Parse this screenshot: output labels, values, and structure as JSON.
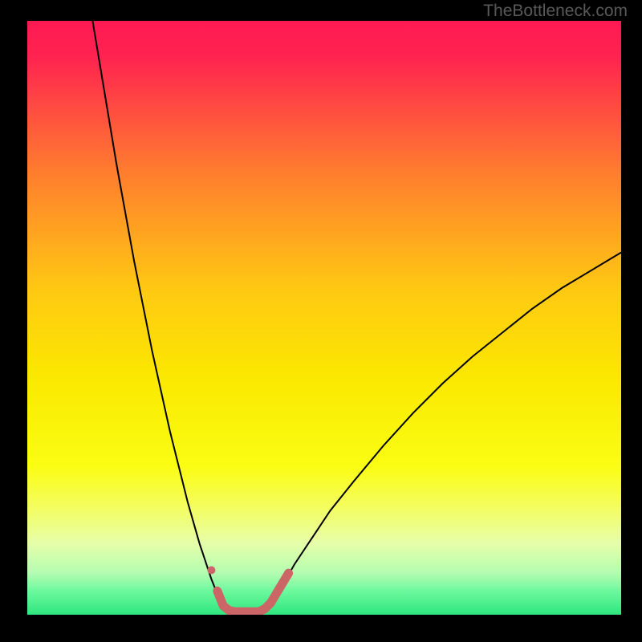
{
  "watermark": "TheBottleneck.com",
  "chart_data": {
    "type": "line",
    "title": "",
    "xlabel": "",
    "ylabel": "",
    "xlim": [
      0,
      100
    ],
    "ylim": [
      0,
      100
    ],
    "background_gradient": {
      "stops": [
        {
          "offset": 0.0,
          "color": "#ff1a52"
        },
        {
          "offset": 0.06,
          "color": "#ff2350"
        },
        {
          "offset": 0.25,
          "color": "#ff7b2f"
        },
        {
          "offset": 0.45,
          "color": "#ffc813"
        },
        {
          "offset": 0.6,
          "color": "#fbe800"
        },
        {
          "offset": 0.75,
          "color": "#fafd13"
        },
        {
          "offset": 0.82,
          "color": "#f4fd61"
        },
        {
          "offset": 0.88,
          "color": "#e6feaa"
        },
        {
          "offset": 0.93,
          "color": "#b3fdb0"
        },
        {
          "offset": 0.96,
          "color": "#6df89e"
        },
        {
          "offset": 1.0,
          "color": "#2ee77f"
        }
      ]
    },
    "series": [
      {
        "name": "left-curve",
        "color": "#000000",
        "width": 2.0,
        "points": [
          {
            "x": 11.0,
            "y": 100.0
          },
          {
            "x": 12.0,
            "y": 94.0
          },
          {
            "x": 13.0,
            "y": 88.0
          },
          {
            "x": 14.0,
            "y": 82.0
          },
          {
            "x": 15.0,
            "y": 76.0
          },
          {
            "x": 16.0,
            "y": 70.5
          },
          {
            "x": 17.0,
            "y": 65.0
          },
          {
            "x": 18.0,
            "y": 59.5
          },
          {
            "x": 19.0,
            "y": 54.5
          },
          {
            "x": 20.0,
            "y": 49.5
          },
          {
            "x": 21.0,
            "y": 44.5
          },
          {
            "x": 22.0,
            "y": 40.0
          },
          {
            "x": 23.0,
            "y": 35.5
          },
          {
            "x": 24.0,
            "y": 31.0
          },
          {
            "x": 25.0,
            "y": 27.0
          },
          {
            "x": 26.0,
            "y": 23.0
          },
          {
            "x": 27.0,
            "y": 19.0
          },
          {
            "x": 28.0,
            "y": 15.5
          },
          {
            "x": 29.0,
            "y": 12.0
          },
          {
            "x": 30.0,
            "y": 9.0
          },
          {
            "x": 31.0,
            "y": 6.0
          },
          {
            "x": 32.0,
            "y": 3.5
          },
          {
            "x": 33.0,
            "y": 1.5
          },
          {
            "x": 34.0,
            "y": 0.5
          },
          {
            "x": 35.0,
            "y": 0.0
          }
        ]
      },
      {
        "name": "right-curve",
        "color": "#000000",
        "width": 2.0,
        "points": [
          {
            "x": 35.0,
            "y": 0.0
          },
          {
            "x": 36.0,
            "y": 0.0
          },
          {
            "x": 37.0,
            "y": 0.0
          },
          {
            "x": 38.0,
            "y": 0.0
          },
          {
            "x": 39.0,
            "y": 0.0
          },
          {
            "x": 40.0,
            "y": 0.5
          },
          {
            "x": 41.0,
            "y": 2.0
          },
          {
            "x": 43.0,
            "y": 5.0
          },
          {
            "x": 45.0,
            "y": 8.5
          },
          {
            "x": 48.0,
            "y": 13.0
          },
          {
            "x": 51.0,
            "y": 17.5
          },
          {
            "x": 55.0,
            "y": 22.5
          },
          {
            "x": 60.0,
            "y": 28.5
          },
          {
            "x": 65.0,
            "y": 34.0
          },
          {
            "x": 70.0,
            "y": 39.0
          },
          {
            "x": 75.0,
            "y": 43.5
          },
          {
            "x": 80.0,
            "y": 47.5
          },
          {
            "x": 85.0,
            "y": 51.5
          },
          {
            "x": 90.0,
            "y": 55.0
          },
          {
            "x": 95.0,
            "y": 58.0
          },
          {
            "x": 100.0,
            "y": 61.0
          }
        ]
      },
      {
        "name": "bottom-overlay",
        "color": "#cc6666",
        "width": 11,
        "linecap": "round",
        "points": [
          {
            "x": 32.0,
            "y": 4.0
          },
          {
            "x": 33.0,
            "y": 1.5
          },
          {
            "x": 34.0,
            "y": 0.7
          },
          {
            "x": 35.0,
            "y": 0.5
          },
          {
            "x": 36.0,
            "y": 0.5
          },
          {
            "x": 37.0,
            "y": 0.5
          },
          {
            "x": 38.0,
            "y": 0.5
          },
          {
            "x": 39.0,
            "y": 0.5
          },
          {
            "x": 40.0,
            "y": 1.0
          },
          {
            "x": 41.0,
            "y": 2.0
          },
          {
            "x": 42.5,
            "y": 4.5
          },
          {
            "x": 44.0,
            "y": 7.0
          }
        ]
      }
    ],
    "markers": [
      {
        "name": "left-dot",
        "x": 31.0,
        "y": 7.5,
        "r": 5.0,
        "color": "#cc6666"
      }
    ]
  }
}
